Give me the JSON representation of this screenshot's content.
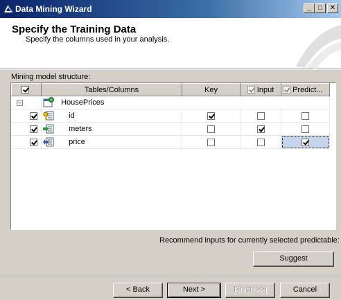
{
  "window": {
    "title": "Data Mining Wizard"
  },
  "header": {
    "title": "Specify the Training Data",
    "subtitle": "Specify the columns used in your analysis."
  },
  "structure_label": "Mining model structure:",
  "grid": {
    "columns": [
      "Tables/Columns",
      "Key",
      "Input",
      "Predict..."
    ],
    "table_name": "HousePrices",
    "rows": [
      {
        "name": "id",
        "include": true,
        "key": true,
        "input": false,
        "predict": false,
        "icon": "key-column-icon"
      },
      {
        "name": "meters",
        "include": true,
        "key": false,
        "input": true,
        "predict": false,
        "icon": "input-column-icon"
      },
      {
        "name": "price",
        "include": true,
        "key": false,
        "input": false,
        "predict": true,
        "icon": "predict-column-icon"
      }
    ]
  },
  "recommend_text": "Recommend inputs for currently selected predictable:",
  "buttons": {
    "suggest": "Suggest",
    "back": "< Back",
    "next": "Next >",
    "finish": "Finish >>|",
    "cancel": "Cancel"
  },
  "colors": {
    "title_bar": "#0a246a",
    "dialog": "#d4d0c8",
    "selection": "#c6d4ec"
  }
}
